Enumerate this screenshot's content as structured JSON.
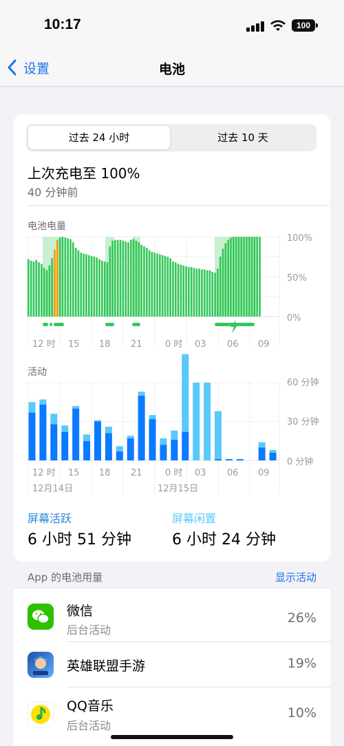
{
  "status": {
    "time": "10:17",
    "battery": "100"
  },
  "nav": {
    "back_label": "设置",
    "title": "电池"
  },
  "segments": [
    "过去 24 小时",
    "过去 10 天"
  ],
  "last_charge": {
    "title": "上次充电至 100%",
    "subtitle": "40 分钟前"
  },
  "battery_chart": {
    "title": "电池电量",
    "y_ticks": [
      "100%",
      "50%",
      "0%"
    ],
    "x_ticks": [
      "12 时",
      "15",
      "18",
      "21",
      "0 时",
      "03",
      "06",
      "09"
    ],
    "colors": {
      "bar": "#34c759",
      "low_power": "#ff9500",
      "charging": "#c8f0d0"
    }
  },
  "activity_chart": {
    "title": "活动",
    "y_ticks": [
      "60 分钟",
      "30 分钟",
      "0 分钟"
    ],
    "x_ticks": [
      "12 时",
      "15",
      "18",
      "21",
      "0 时",
      "03",
      "06",
      "09"
    ],
    "dates": [
      "12月14日",
      "12月15日"
    ],
    "colors": {
      "screen_on": "#0a7aff",
      "screen_off": "#5ac8fa"
    }
  },
  "chart_data": [
    {
      "type": "bar",
      "title": "电池电量",
      "ylim": [
        0,
        100
      ],
      "values": [
        72,
        70,
        69,
        71,
        68,
        66,
        61,
        58,
        64,
        73,
        84,
        96,
        99,
        100,
        99,
        98,
        97,
        93,
        86,
        83,
        80,
        79,
        78,
        77,
        76,
        75,
        74,
        72,
        70,
        69,
        68,
        88,
        95,
        96,
        96,
        96,
        95,
        94,
        93,
        96,
        97,
        95,
        93,
        90,
        88,
        86,
        83,
        81,
        80,
        79,
        78,
        77,
        76,
        75,
        73,
        69,
        68,
        66,
        65,
        64,
        63,
        62,
        62,
        61,
        60,
        60,
        59,
        59,
        58,
        58,
        56,
        55,
        60,
        75,
        85,
        92,
        96,
        99,
        100,
        100,
        100,
        100,
        100,
        100,
        100,
        100,
        100,
        100,
        100
      ]
    },
    {
      "type": "bar",
      "title": "活动",
      "ylim": [
        0,
        60
      ],
      "series": [
        {
          "values": [
            37,
            43,
            28,
            22,
            40,
            15,
            30,
            21,
            7,
            17,
            50,
            32,
            12,
            16,
            22,
            0,
            0,
            1,
            1,
            1,
            0,
            10,
            6
          ]
        },
        {
          "values": [
            8,
            4,
            8,
            5,
            2,
            5,
            1,
            5,
            4,
            2,
            3,
            3,
            5,
            7,
            60,
            60,
            60,
            37,
            0,
            0,
            0,
            4,
            2
          ]
        }
      ]
    }
  ],
  "stats": {
    "screen_on_label": "屏幕活跃",
    "screen_on_value": "6 小时 51 分钟",
    "screen_off_label": "屏幕闲置",
    "screen_off_value": "6 小时 24 分钟"
  },
  "usage": {
    "header": "App 的电池用量",
    "show_activity": "显示活动",
    "apps": [
      {
        "name": "微信",
        "sub": "后台活动",
        "pct": "26%",
        "icon": "wechat-icon"
      },
      {
        "name": "英雄联盟手游",
        "sub": "",
        "pct": "19%",
        "icon": "game-icon"
      },
      {
        "name": "QQ音乐",
        "sub": "后台活动",
        "pct": "10%",
        "icon": "qq-music-icon"
      }
    ]
  }
}
